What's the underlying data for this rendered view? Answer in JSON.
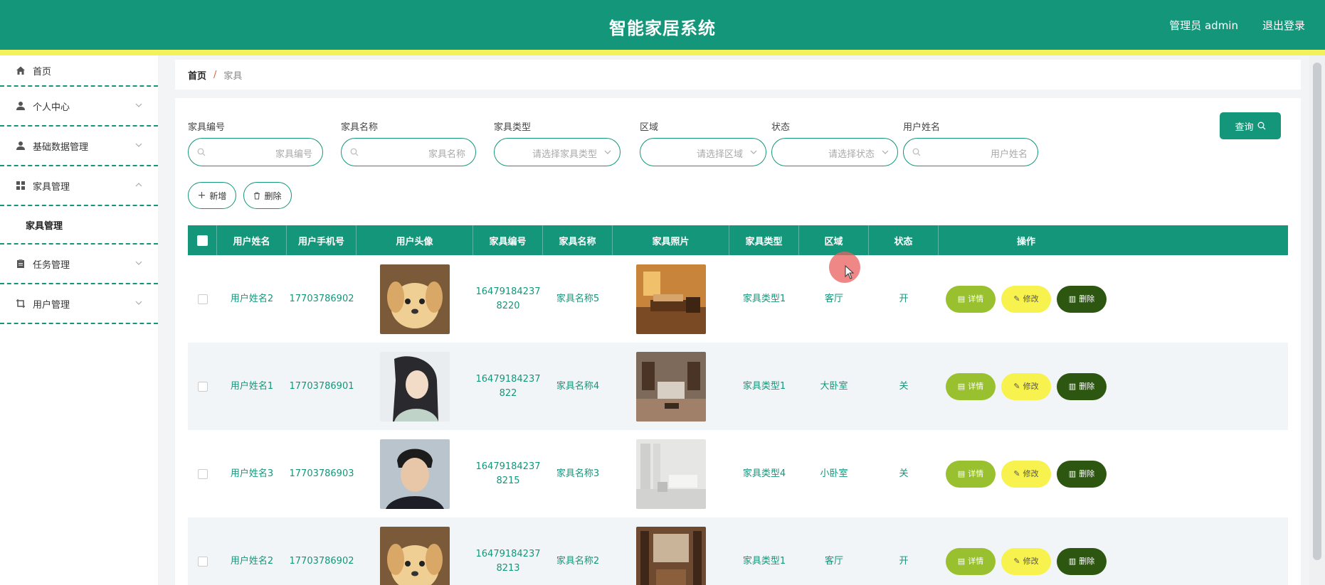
{
  "header": {
    "title": "智能家居系统",
    "user_label": "管理员 admin",
    "logout_label": "退出登录"
  },
  "sidebar": {
    "items": [
      {
        "label": "首页",
        "icon": "home-icon"
      },
      {
        "label": "个人中心",
        "icon": "user-icon"
      },
      {
        "label": "基础数据管理",
        "icon": "user-icon"
      },
      {
        "label": "家具管理",
        "icon": "grid-icon"
      },
      {
        "label": "任务管理",
        "icon": "clipboard-icon"
      },
      {
        "label": "用户管理",
        "icon": "crop-icon"
      }
    ],
    "submenu": {
      "label": "家具管理"
    }
  },
  "breadcrumb": {
    "home": "首页",
    "separator": "/",
    "current": "家具"
  },
  "filters": {
    "code_label": "家具编号",
    "code_placeholder": "家具编号",
    "name_label": "家具名称",
    "name_placeholder": "家具名称",
    "type_label": "家具类型",
    "type_placeholder": "请选择家具类型",
    "area_label": "区域",
    "area_placeholder": "请选择区域",
    "status_label": "状态",
    "status_placeholder": "请选择状态",
    "username_label": "用户姓名",
    "username_placeholder": "用户姓名",
    "query_label": "查询"
  },
  "toolbar": {
    "add_label": "新增",
    "delete_label": "删除"
  },
  "table": {
    "headers": [
      "用户姓名",
      "用户手机号",
      "用户头像",
      "家具编号",
      "家具名称",
      "家具照片",
      "家具类型",
      "区域",
      "状态",
      "操作"
    ],
    "rows": [
      {
        "username": "用户姓名2",
        "phone": "17703786902",
        "code_line1": "16479184237",
        "code_line2": "8220",
        "name": "家具名称5",
        "type": "家具类型1",
        "area": "客厅",
        "status": "开"
      },
      {
        "username": "用户姓名1",
        "phone": "17703786901",
        "code_line1": "16479184237",
        "code_line2": "822",
        "name": "家具名称4",
        "type": "家具类型1",
        "area": "大卧室",
        "status": "关"
      },
      {
        "username": "用户姓名3",
        "phone": "17703786903",
        "code_line1": "16479184237",
        "code_line2": "8215",
        "name": "家具名称3",
        "type": "家具类型4",
        "area": "小卧室",
        "status": "关"
      },
      {
        "username": "用户姓名2",
        "phone": "17703786902",
        "code_line1": "16479184237",
        "code_line2": "8213",
        "name": "家具名称2",
        "type": "家具类型1",
        "area": "客厅",
        "status": "开"
      }
    ],
    "actions": {
      "detail": "详情",
      "edit": "修改",
      "delete": "删除"
    }
  },
  "colors": {
    "primary": "#14967a",
    "stripe": "#f4f25c",
    "detail": "#98c02f",
    "edit": "#f7f24e",
    "delete": "#2d5710"
  }
}
